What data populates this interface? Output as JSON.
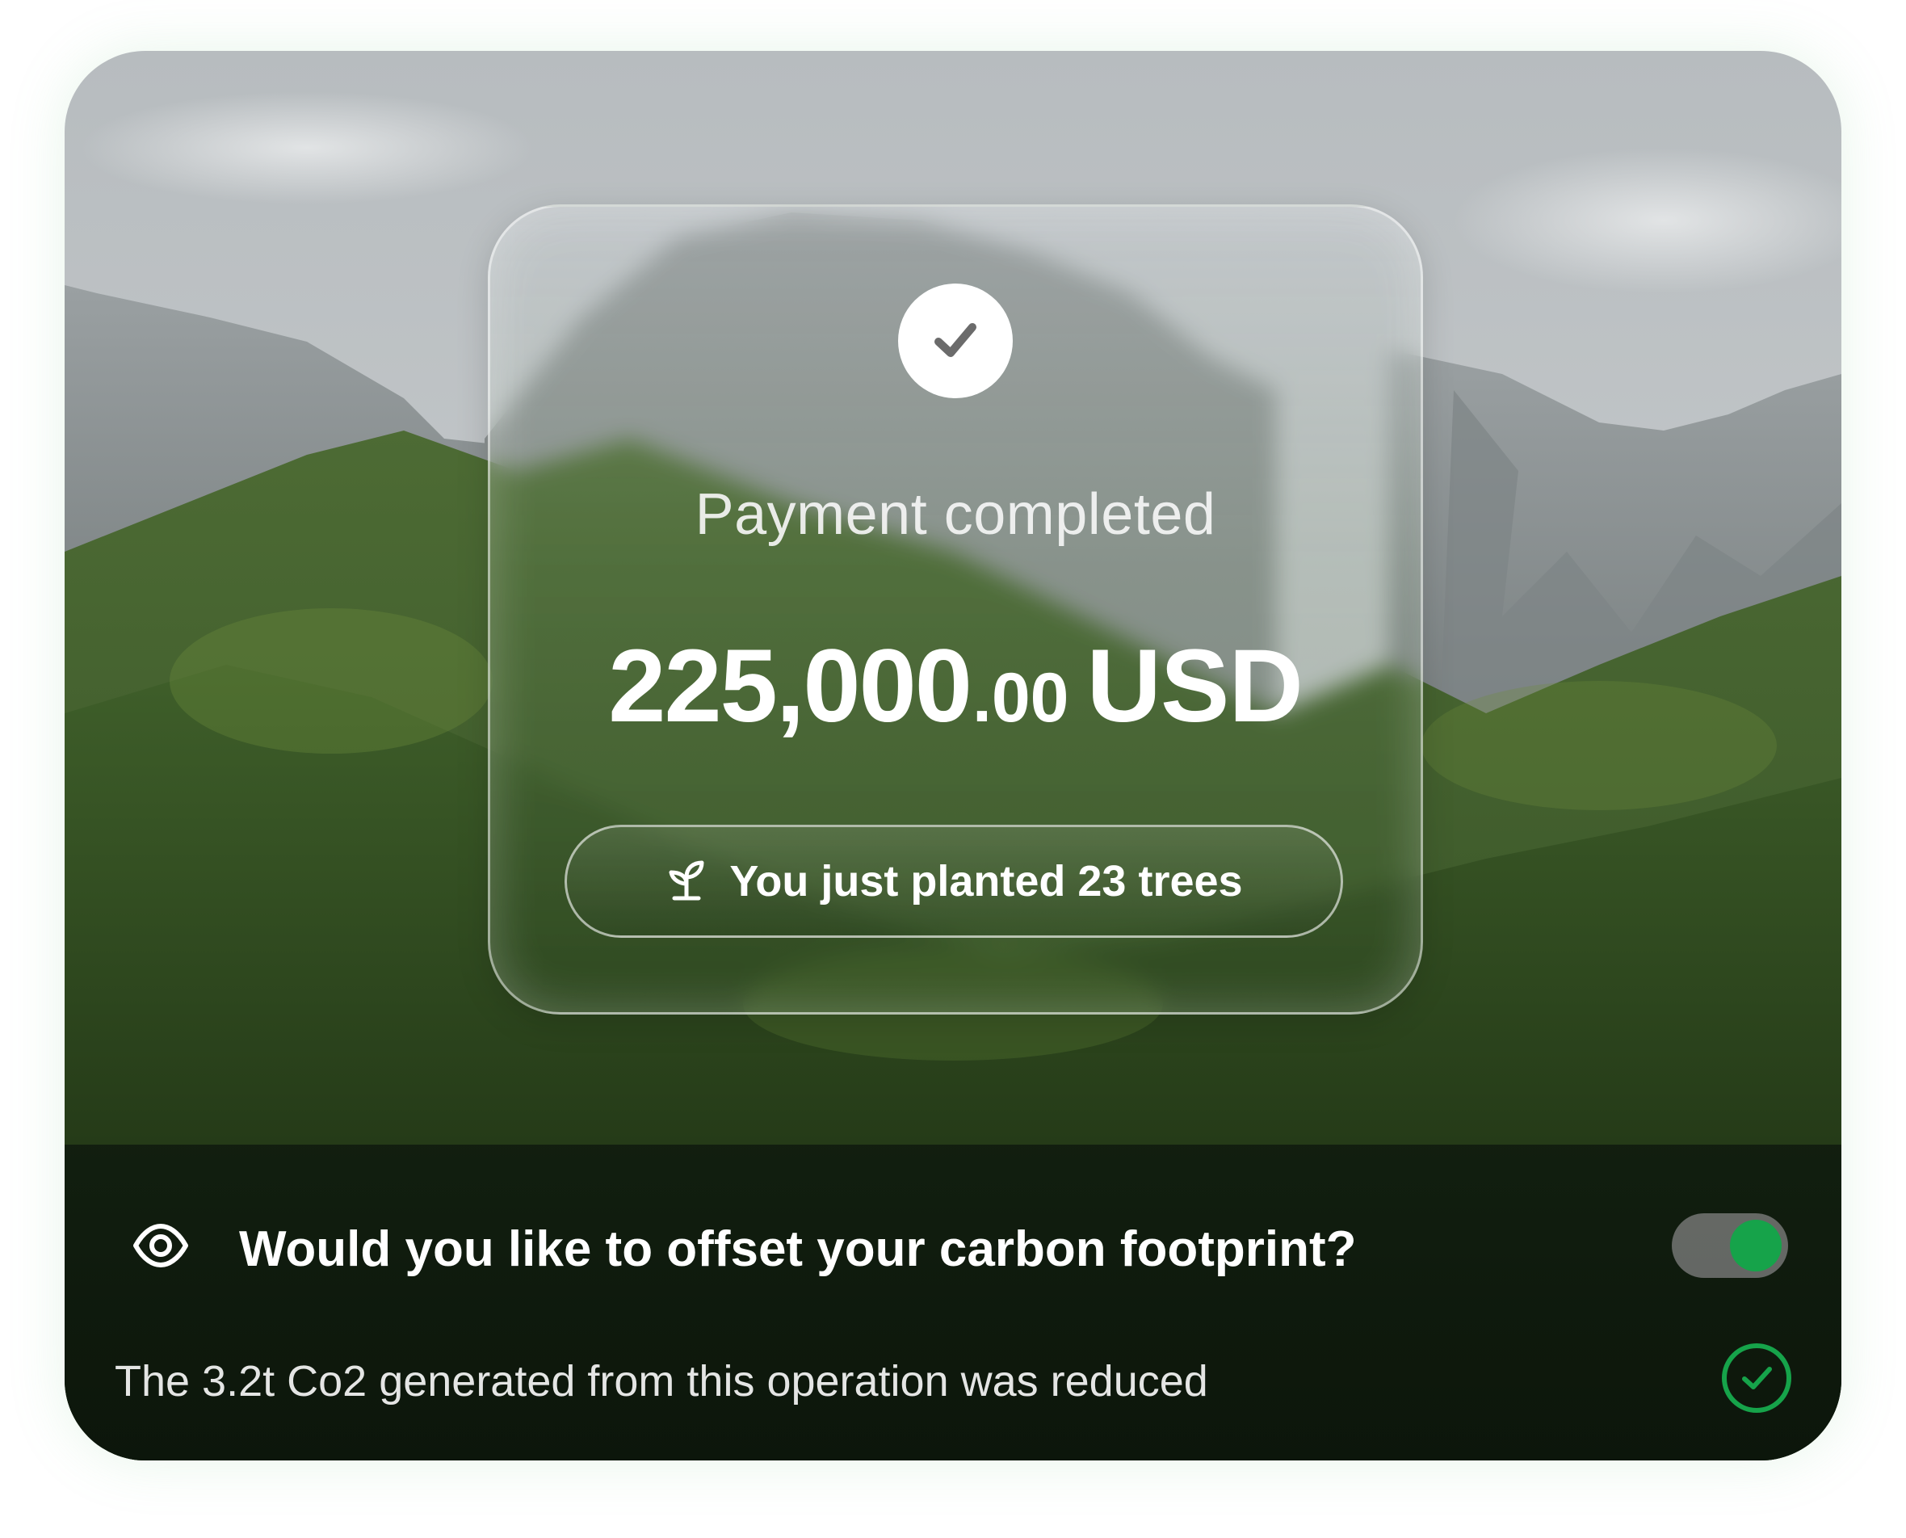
{
  "payment": {
    "status_title": "Payment completed",
    "amount_major": "225,000",
    "amount_minor": ".00",
    "currency": "USD"
  },
  "trees": {
    "label": "You just planted 23 trees",
    "icon": "sprout-icon"
  },
  "carbon": {
    "question": "Would you like to offset your carbon footprint?",
    "icon": "eye-icon",
    "offset_enabled": true,
    "result_text": "The 3.2t Co2 generated from this operation was reduced",
    "result_icon": "check-circle-icon"
  },
  "colors": {
    "accent_green": "#16a34a",
    "white": "#ffffff"
  }
}
